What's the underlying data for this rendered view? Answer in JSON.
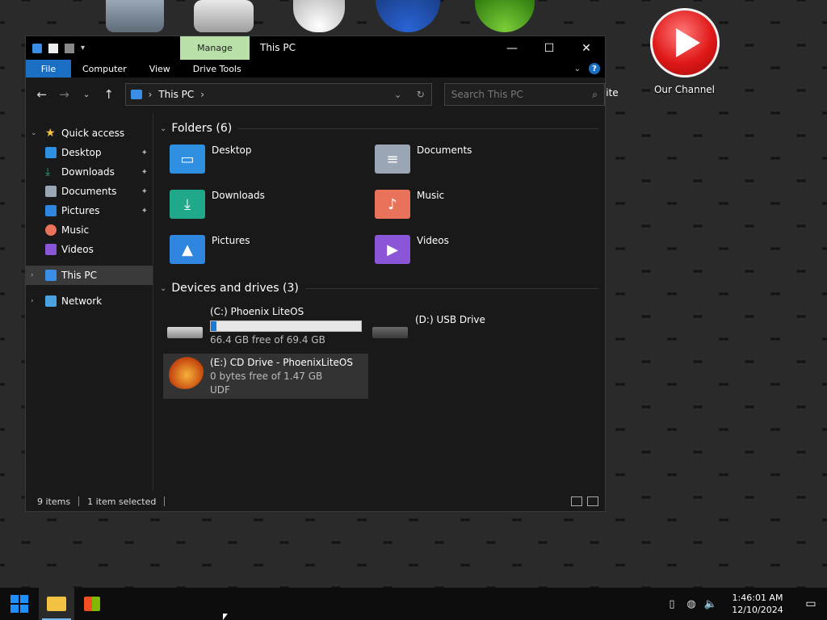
{
  "desktop": {
    "site_label": "site",
    "channel_label": "Our Channel"
  },
  "window": {
    "context_tab": "Manage",
    "title": "This PC",
    "ribbon": {
      "file": "File",
      "computer": "Computer",
      "view": "View",
      "drive_tools": "Drive Tools"
    },
    "address": {
      "location": "This PC"
    },
    "search": {
      "placeholder": "Search This PC"
    }
  },
  "sidebar": {
    "quick_access": "Quick access",
    "items": [
      {
        "label": "Desktop"
      },
      {
        "label": "Downloads"
      },
      {
        "label": "Documents"
      },
      {
        "label": "Pictures"
      },
      {
        "label": "Music"
      },
      {
        "label": "Videos"
      }
    ],
    "this_pc": "This PC",
    "network": "Network"
  },
  "content": {
    "folders_heading": "Folders (6)",
    "folders": [
      {
        "name": "Desktop",
        "color": "#2f8fe0"
      },
      {
        "name": "Documents",
        "color": "#9aa6b4"
      },
      {
        "name": "Downloads",
        "color": "#1fa88a"
      },
      {
        "name": "Music",
        "color": "#e8735a"
      },
      {
        "name": "Pictures",
        "color": "#2e86de"
      },
      {
        "name": "Videos",
        "color": "#8b55d8"
      }
    ],
    "drives_heading": "Devices and drives (3)",
    "drives": [
      {
        "name": "(C:) Phoenix LiteOS",
        "usage": 0.04,
        "space": "66.4 GB free of 69.4 GB"
      },
      {
        "name": "(D:) USB Drive"
      },
      {
        "name": "(E:) CD Drive - PhoenixLiteOS",
        "space": "0 bytes free of 1.47 GB",
        "fs": "UDF"
      }
    ]
  },
  "status": {
    "items": "9 items",
    "selected": "1 item selected"
  },
  "taskbar": {
    "time": "1:46:01 AM",
    "date": "12/10/2024"
  },
  "colors": {
    "accent": "#1a6fc4",
    "manage_tab": "#b8e0a8"
  }
}
